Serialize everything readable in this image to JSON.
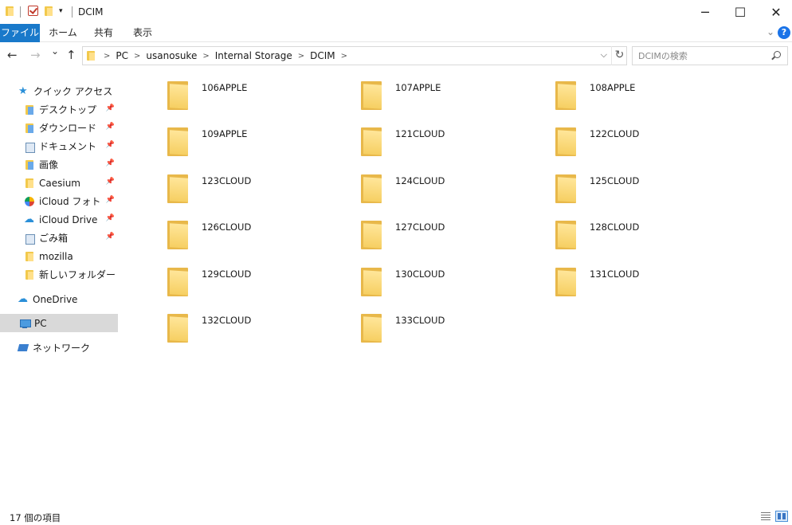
{
  "window": {
    "title": "DCIM",
    "minimize_label": "─",
    "maximize_label": "☐",
    "close_label": "✕"
  },
  "ribbon": {
    "tabs": [
      {
        "label": "ファイル",
        "active": true
      },
      {
        "label": "ホーム",
        "active": false
      },
      {
        "label": "共有",
        "active": false
      },
      {
        "label": "表示",
        "active": false
      }
    ],
    "help_label": "?"
  },
  "navigation": {
    "back_label": "←",
    "forward_label": "→",
    "recent_label": "⌄",
    "up_label": "↑",
    "breadcrumb": [
      "PC",
      "usanosuke",
      "Internal Storage",
      "DCIM"
    ],
    "search_placeholder": "DCIMの検索"
  },
  "sidebar": {
    "quick_access_label": "クイック アクセス",
    "quick_access_items": [
      {
        "label": "デスクトップ",
        "icon": "desktop-icon",
        "pinned": true
      },
      {
        "label": "ダウンロード",
        "icon": "download-icon",
        "pinned": true
      },
      {
        "label": "ドキュメント",
        "icon": "document-icon",
        "pinned": true
      },
      {
        "label": "画像",
        "icon": "pictures-icon",
        "pinned": true
      },
      {
        "label": "Caesium",
        "icon": "folder-icon",
        "pinned": true
      },
      {
        "label": "iCloud フォト",
        "icon": "icloud-photos-icon",
        "pinned": true
      },
      {
        "label": "iCloud Drive",
        "icon": "icloud-drive-icon",
        "pinned": true
      },
      {
        "label": "ごみ箱",
        "icon": "recycle-bin-icon",
        "pinned": true
      },
      {
        "label": "mozilla",
        "icon": "folder-icon",
        "pinned": false
      },
      {
        "label": "新しいフォルダー",
        "icon": "folder-icon",
        "pinned": false
      }
    ],
    "onedrive_label": "OneDrive",
    "pc_label": "PC",
    "network_label": "ネットワーク"
  },
  "folders": [
    "106APPLE",
    "107APPLE",
    "108APPLE",
    "109APPLE",
    "121CLOUD",
    "122CLOUD",
    "123CLOUD",
    "124CLOUD",
    "125CLOUD",
    "126CLOUD",
    "127CLOUD",
    "128CLOUD",
    "129CLOUD",
    "130CLOUD",
    "131CLOUD",
    "132CLOUD",
    "133CLOUD"
  ],
  "status": {
    "item_count_text": "17 個の項目"
  },
  "colors": {
    "accent": "#1979ca",
    "folder": "#f2c94c",
    "selection": "#d9d9d9"
  }
}
